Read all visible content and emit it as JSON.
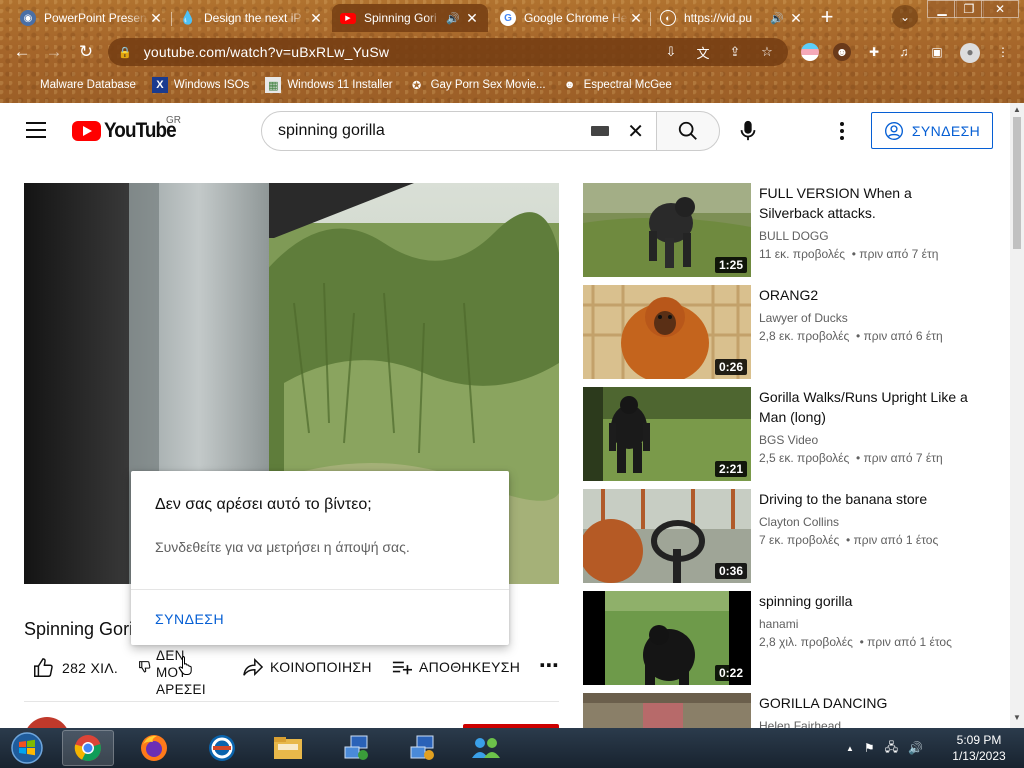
{
  "browser": {
    "tabs": [
      {
        "title": "PowerPoint Presen",
        "active": false,
        "audio": false
      },
      {
        "title": "Design the next iP",
        "active": false,
        "audio": false
      },
      {
        "title": "Spinning Gori",
        "active": true,
        "audio": true
      },
      {
        "title": "Google Chrome He",
        "active": false,
        "audio": false
      },
      {
        "title": "https://vid.pu",
        "active": false,
        "audio": true
      }
    ],
    "new_tab_symbol": "+",
    "tab_close_symbol": "✕",
    "url": "youtube.com/watch?v=uBxRLw_YuSw",
    "bookmarks": [
      {
        "label": "Malware Database",
        "icon": "blank-page-icon"
      },
      {
        "label": "Windows ISOs",
        "icon": "x-logo-icon"
      },
      {
        "label": "Windows 11 Installer",
        "icon": "image-icon"
      },
      {
        "label": "Gay Porn Sex Movie...",
        "icon": "globe-icon"
      },
      {
        "label": "Espectral McGee",
        "icon": "avatar-icon"
      }
    ],
    "theme_color": "#a8692a"
  },
  "youtube": {
    "logo_text": "YouTube",
    "country_code": "GR",
    "search_query": "spinning gorilla",
    "sign_in_label": "ΣΥΝΔΕΣΗ",
    "accent_blue": "#065fd4",
    "video": {
      "title": "Spinning Gori",
      "likes": "282 ΧΙΛ.",
      "dislike_line1": "ΔΕΝ",
      "dislike_line2": "ΜΟΥ",
      "dislike_line3": "ΑΡΕΣΕΙ",
      "share_label": "ΚΟΙΝΟΠΟΙΗΣΗ",
      "save_label": "ΑΠΟΘΗΚΕΥΣΗ"
    },
    "dislike_dialog": {
      "title": "Δεν σας αρέσει αυτό το βίντεο;",
      "subtitle": "Συνδεθείτε για να μετρήσει η άποψή σας.",
      "button": "ΣΥΝΔΕΣΗ"
    },
    "related": [
      {
        "title": "FULL VERSION When a Silverback attacks.",
        "channel": "BULL DOGG",
        "views": "11 εκ. προβολές",
        "age": "πριν από 7 έτη",
        "duration": "1:25"
      },
      {
        "title": "ORANG2",
        "channel": "Lawyer of Ducks",
        "views": "2,8 εκ. προβολές",
        "age": "πριν από 6 έτη",
        "duration": "0:26"
      },
      {
        "title": "Gorilla Walks/Runs Upright Like a Man (long)",
        "channel": "BGS Video",
        "views": "2,5 εκ. προβολές",
        "age": "πριν από 7 έτη",
        "duration": "2:21"
      },
      {
        "title": "Driving to the banana store",
        "channel": "Clayton Collins",
        "views": "7 εκ. προβολές",
        "age": "πριν από 1 έτος",
        "duration": "0:36"
      },
      {
        "title": "spinning gorilla",
        "channel": "hanami",
        "views": "2,8 χιλ. προβολές",
        "age": "πριν από 1 έτος",
        "duration": "0:22"
      },
      {
        "title": "GORILLA DANCING",
        "channel": "Helen Fairhead",
        "views": "",
        "age": "",
        "duration": ""
      }
    ],
    "meta_separator": "•"
  },
  "taskbar": {
    "apps": [
      "windows-start-icon",
      "chrome-icon",
      "firefox-icon",
      "outlook-icon",
      "file-explorer-icon",
      "network-app-icon",
      "network-app-icon-2",
      "users-icon"
    ],
    "time": "5:09 PM",
    "date": "1/13/2023",
    "tray_expand_symbol": "▲"
  }
}
